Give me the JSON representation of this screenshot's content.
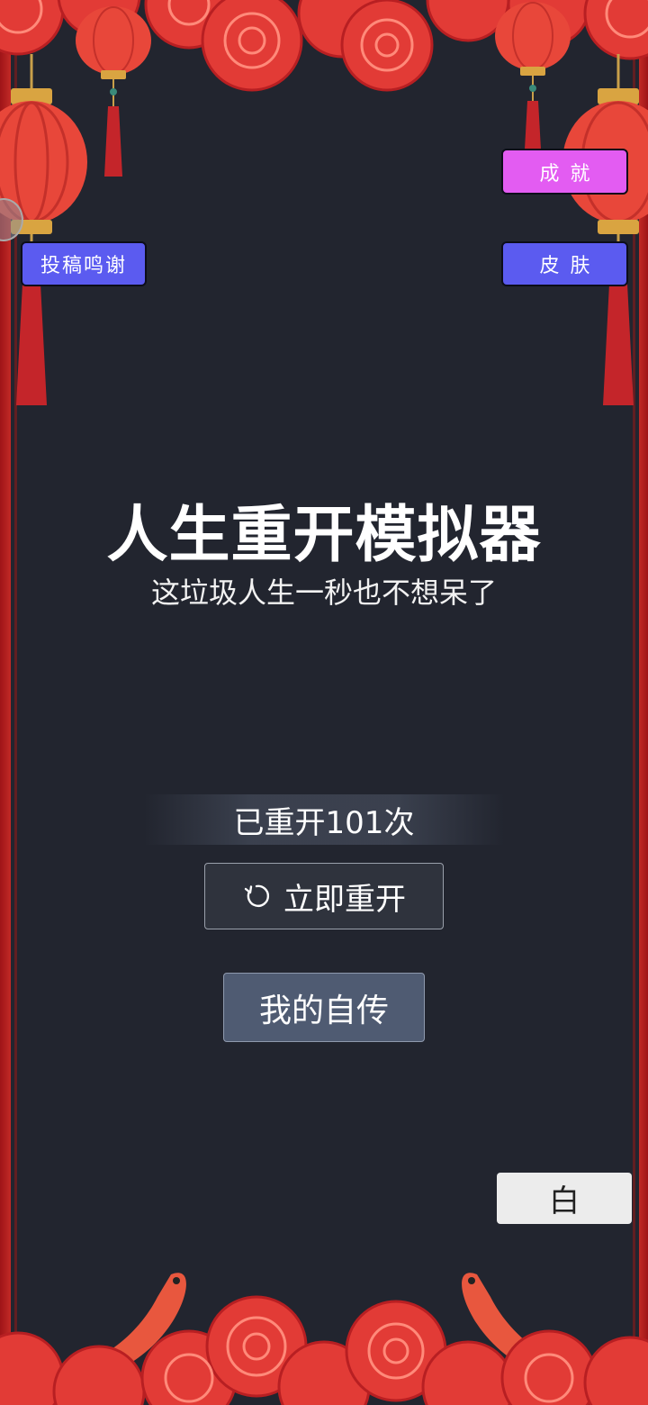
{
  "top_buttons": {
    "thanks_label": "投稿鸣谢",
    "achievements_label": "成就",
    "skin_label": "皮肤"
  },
  "main": {
    "title": "人生重开模拟器",
    "subtitle": "这垃圾人生一秒也不想呆了",
    "restart_count": "已重开101次",
    "restart_label": "立即重开",
    "bio_label": "我的自传",
    "theme_label": "白"
  },
  "icons": {
    "restart": "refresh-icon"
  },
  "colors": {
    "background": "#22252f",
    "frame_red": "#c22a26",
    "thanks_button": "#5b5bf0",
    "achievements_button": "#e35cf2",
    "skin_button": "#5b5bf0",
    "bio_button": "#4f5b72",
    "theme_button": "#ececec"
  }
}
